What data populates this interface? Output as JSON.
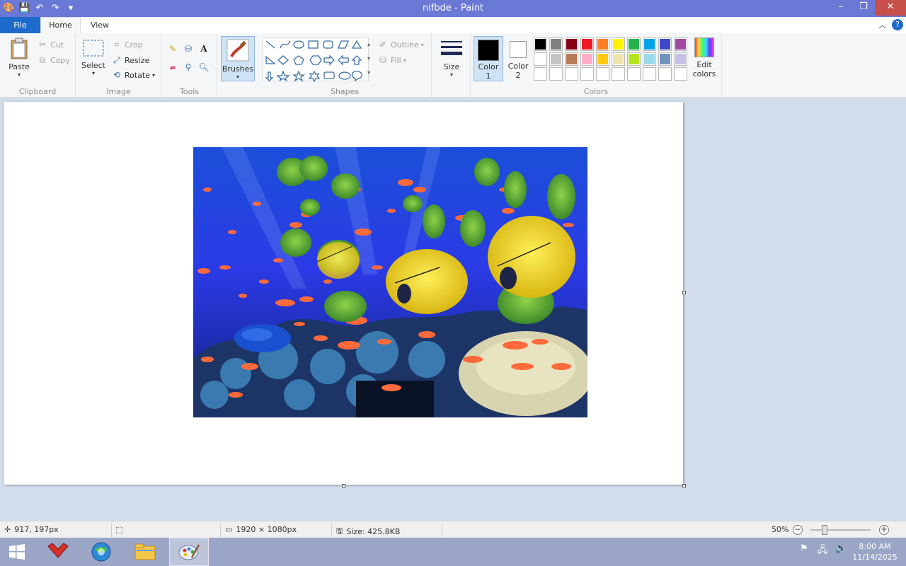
{
  "window": {
    "title": "nifbde - Paint",
    "minimize_glyph": "–",
    "restore_glyph": "❐",
    "close_glyph": "✕"
  },
  "tabs": {
    "file": "File",
    "home": "Home",
    "view": "View"
  },
  "ribbon": {
    "clipboard": {
      "label": "Clipboard",
      "paste": "Paste",
      "cut": "Cut",
      "copy": "Copy"
    },
    "image": {
      "label": "Image",
      "select": "Select",
      "crop": "Crop",
      "resize": "Resize",
      "rotate": "Rotate"
    },
    "tools": {
      "label": "Tools"
    },
    "brushes": {
      "label": "Brushes"
    },
    "shapes": {
      "label": "Shapes",
      "outline": "Outline",
      "fill": "Fill"
    },
    "size": {
      "label": "Size"
    },
    "colors": {
      "label": "Colors",
      "color1_a": "Color",
      "color1_b": "1",
      "color2_a": "Color",
      "color2_b": "2",
      "edit_a": "Edit",
      "edit_b": "colors",
      "color1_value": "#000000",
      "color2_value": "#ffffff",
      "palette_row1": [
        "#000000",
        "#7f7f7f",
        "#880015",
        "#ed1c24",
        "#ff7f27",
        "#fff200",
        "#22b14c",
        "#00a2e8",
        "#3f48cc",
        "#a349a4"
      ],
      "palette_row2": [
        "#ffffff",
        "#c3c3c3",
        "#b97a57",
        "#ffaec9",
        "#ffc90e",
        "#efe4b0",
        "#b5e61d",
        "#99d9ea",
        "#7092be",
        "#c8bfe7"
      ]
    }
  },
  "status": {
    "cursor_pos": "917, 197px",
    "image_size": "1920 × 1080px",
    "file_size": "Size: 425.8KB",
    "zoom": "50%"
  },
  "taskbar": {
    "time": "8:00 AM",
    "date": "11/14/2025"
  }
}
